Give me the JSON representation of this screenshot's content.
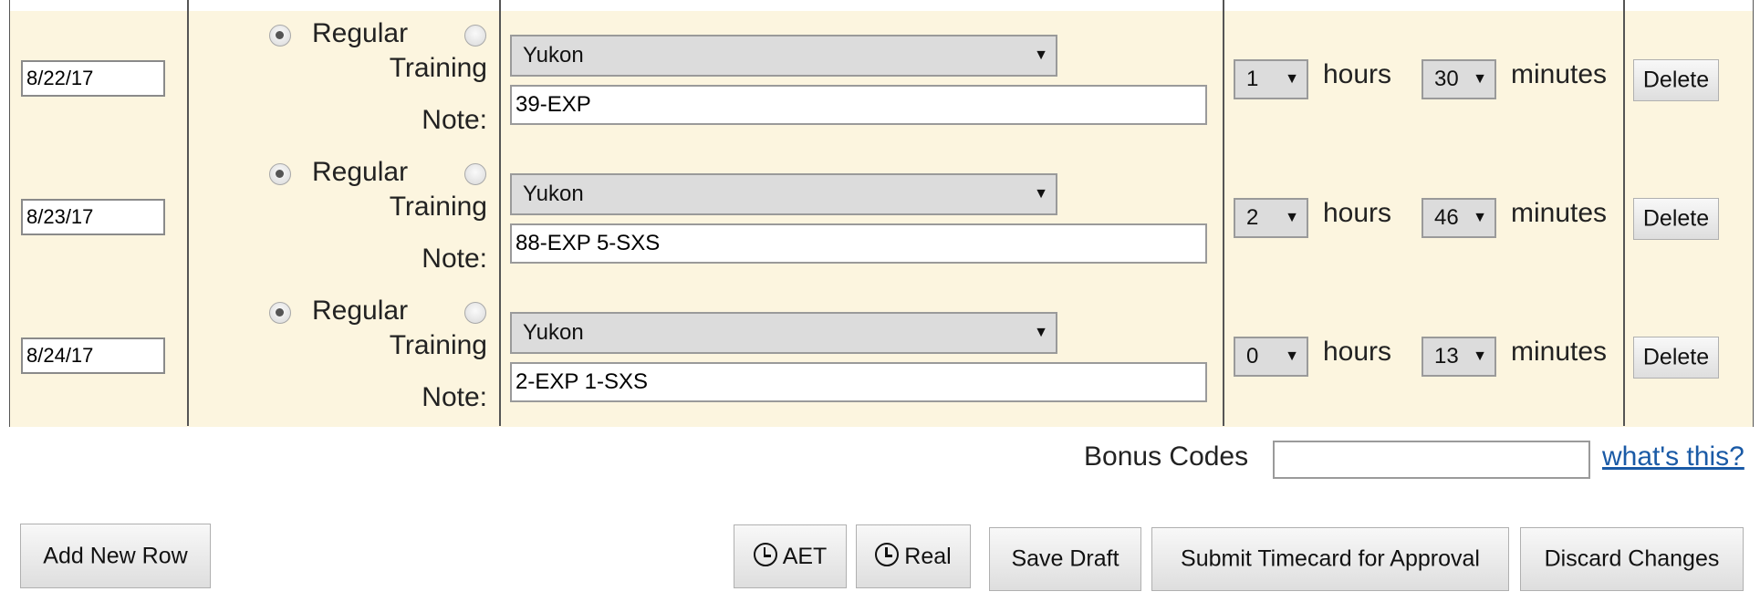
{
  "rows": [
    {
      "date": "8/22/17",
      "type_regular": "Regular",
      "type_training": "Training",
      "note_label": "Note:",
      "project": "Yukon",
      "note": "39-EXP",
      "hours": "1",
      "hours_label": "hours",
      "minutes": "30",
      "minutes_label": "minutes",
      "delete_label": "Delete"
    },
    {
      "date": "8/23/17",
      "type_regular": "Regular",
      "type_training": "Training",
      "note_label": "Note:",
      "project": "Yukon",
      "note": "88-EXP 5-SXS",
      "hours": "2",
      "hours_label": "hours",
      "minutes": "46",
      "minutes_label": "minutes",
      "delete_label": "Delete"
    },
    {
      "date": "8/24/17",
      "type_regular": "Regular",
      "type_training": "Training",
      "note_label": "Note:",
      "project": "Yukon",
      "note": "2-EXP 1-SXS",
      "hours": "0",
      "hours_label": "hours",
      "minutes": "13",
      "minutes_label": "minutes",
      "delete_label": "Delete"
    }
  ],
  "bonus": {
    "label": "Bonus Codes",
    "value": "",
    "help_link": "what's this?"
  },
  "actions": {
    "add_row": "Add New Row",
    "aet": "AET",
    "real": "Real",
    "save_draft": "Save Draft",
    "submit": "Submit Timecard for Approval",
    "discard": "Discard Changes"
  }
}
